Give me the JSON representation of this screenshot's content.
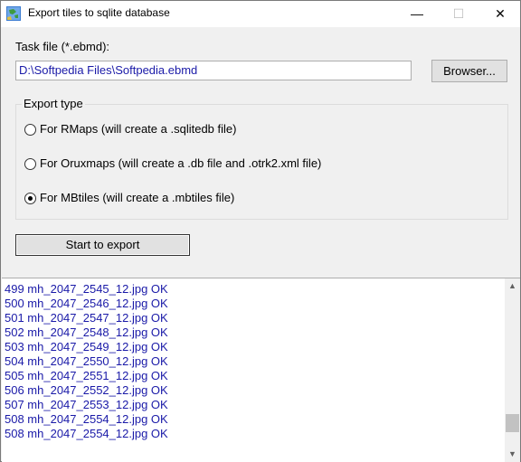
{
  "window": {
    "title": "Export tiles to sqlite database",
    "minimize_glyph": "—",
    "maximize_glyph": "☐",
    "close_glyph": "✕"
  },
  "task": {
    "label": "Task file (*.ebmd):",
    "value": "D:\\Softpedia Files\\Softpedia.ebmd",
    "browse_label": "Browser..."
  },
  "export_type": {
    "legend": "Export type",
    "options": [
      {
        "label": "For RMaps (will create a .sqlitedb file)",
        "selected": false
      },
      {
        "label": "For Oruxmaps (will create a .db file and .otrk2.xml file)",
        "selected": false
      },
      {
        "label": "For MBtiles (will create a .mbtiles file)",
        "selected": true
      }
    ]
  },
  "start_label": "Start to export",
  "log": [
    "499 mh_2047_2545_12.jpg OK",
    "500 mh_2047_2546_12.jpg OK",
    "501 mh_2047_2547_12.jpg OK",
    "502 mh_2047_2548_12.jpg OK",
    "503 mh_2047_2549_12.jpg OK",
    "504 mh_2047_2550_12.jpg OK",
    "505 mh_2047_2551_12.jpg OK",
    "506 mh_2047_2552_12.jpg OK",
    "507 mh_2047_2553_12.jpg OK",
    "508 mh_2047_2554_12.jpg OK",
    "508 mh_2047_2554_12.jpg OK"
  ],
  "scroll_up_glyph": "▲",
  "scroll_down_glyph": "▼"
}
